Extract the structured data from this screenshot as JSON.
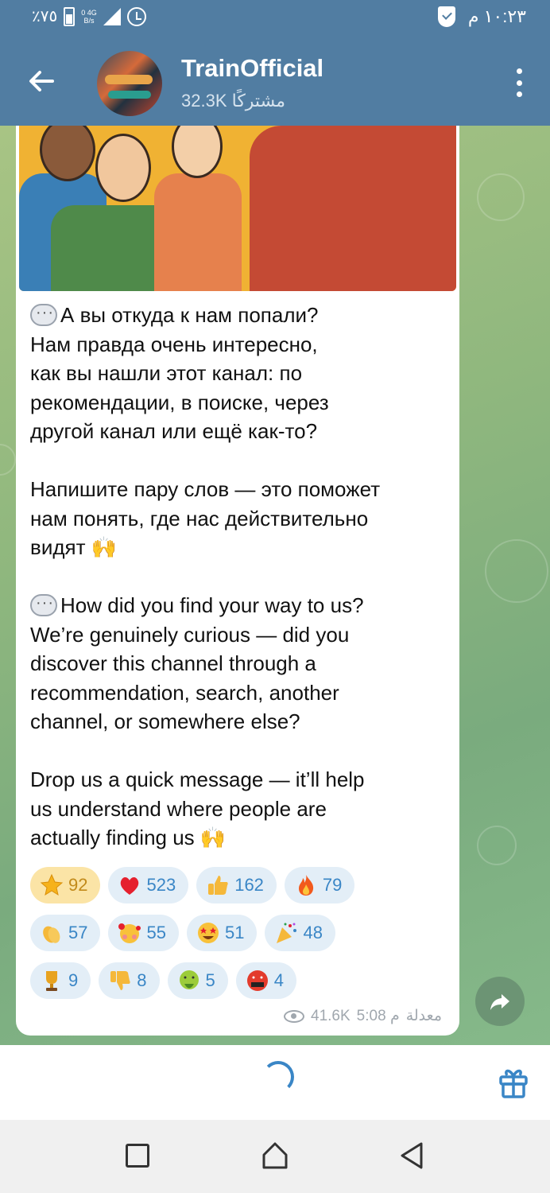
{
  "status_bar": {
    "battery": "٪٧٥",
    "net_speed": "0",
    "net_unit": "B/s",
    "net_type": "4G",
    "time": "١٠:٢٣ م"
  },
  "header": {
    "title": "TrainOfficial",
    "subscribers": "32.3K مشتركًا"
  },
  "message": {
    "text_ru_1": "А вы откуда к нам попали?\nНам правда очень интересно,\nкак вы нашли этот канал: по\nрекомендации, в поиске, через\nдругой канал или ещё как-то?",
    "text_ru_2": "Напишите пару слов — это поможет\nнам понять, где нас действительно\nвидят 🙌",
    "text_en_1": "How did you find your way to us?\nWe’re genuinely curious — did you\ndiscover this channel through a\nrecommendation, search, another\nchannel, or somewhere else?",
    "text_en_2": "Drop us a quick message — it’ll help\nus understand where people are\nactually finding us 🙌",
    "reactions": [
      {
        "icon": "star-icon",
        "count": "92"
      },
      {
        "icon": "heart-icon",
        "count": "523"
      },
      {
        "icon": "thumbs-up-icon",
        "count": "162"
      },
      {
        "icon": "fire-icon",
        "count": "79"
      },
      {
        "icon": "clap-icon",
        "count": "57"
      },
      {
        "icon": "smiling-hearts-icon",
        "count": "55"
      },
      {
        "icon": "star-struck-icon",
        "count": "51"
      },
      {
        "icon": "party-popper-icon",
        "count": "48"
      },
      {
        "icon": "trophy-icon",
        "count": "9"
      },
      {
        "icon": "thumbs-down-icon",
        "count": "8"
      },
      {
        "icon": "nauseated-icon",
        "count": "5"
      },
      {
        "icon": "swearing-face-icon",
        "count": "4"
      }
    ],
    "views": "41.6K",
    "time": "5:08 م",
    "edited": "معدلة"
  },
  "colors": {
    "header": "#517da2",
    "accent": "#3a86c6",
    "star_chip": "#fbe4a6"
  }
}
